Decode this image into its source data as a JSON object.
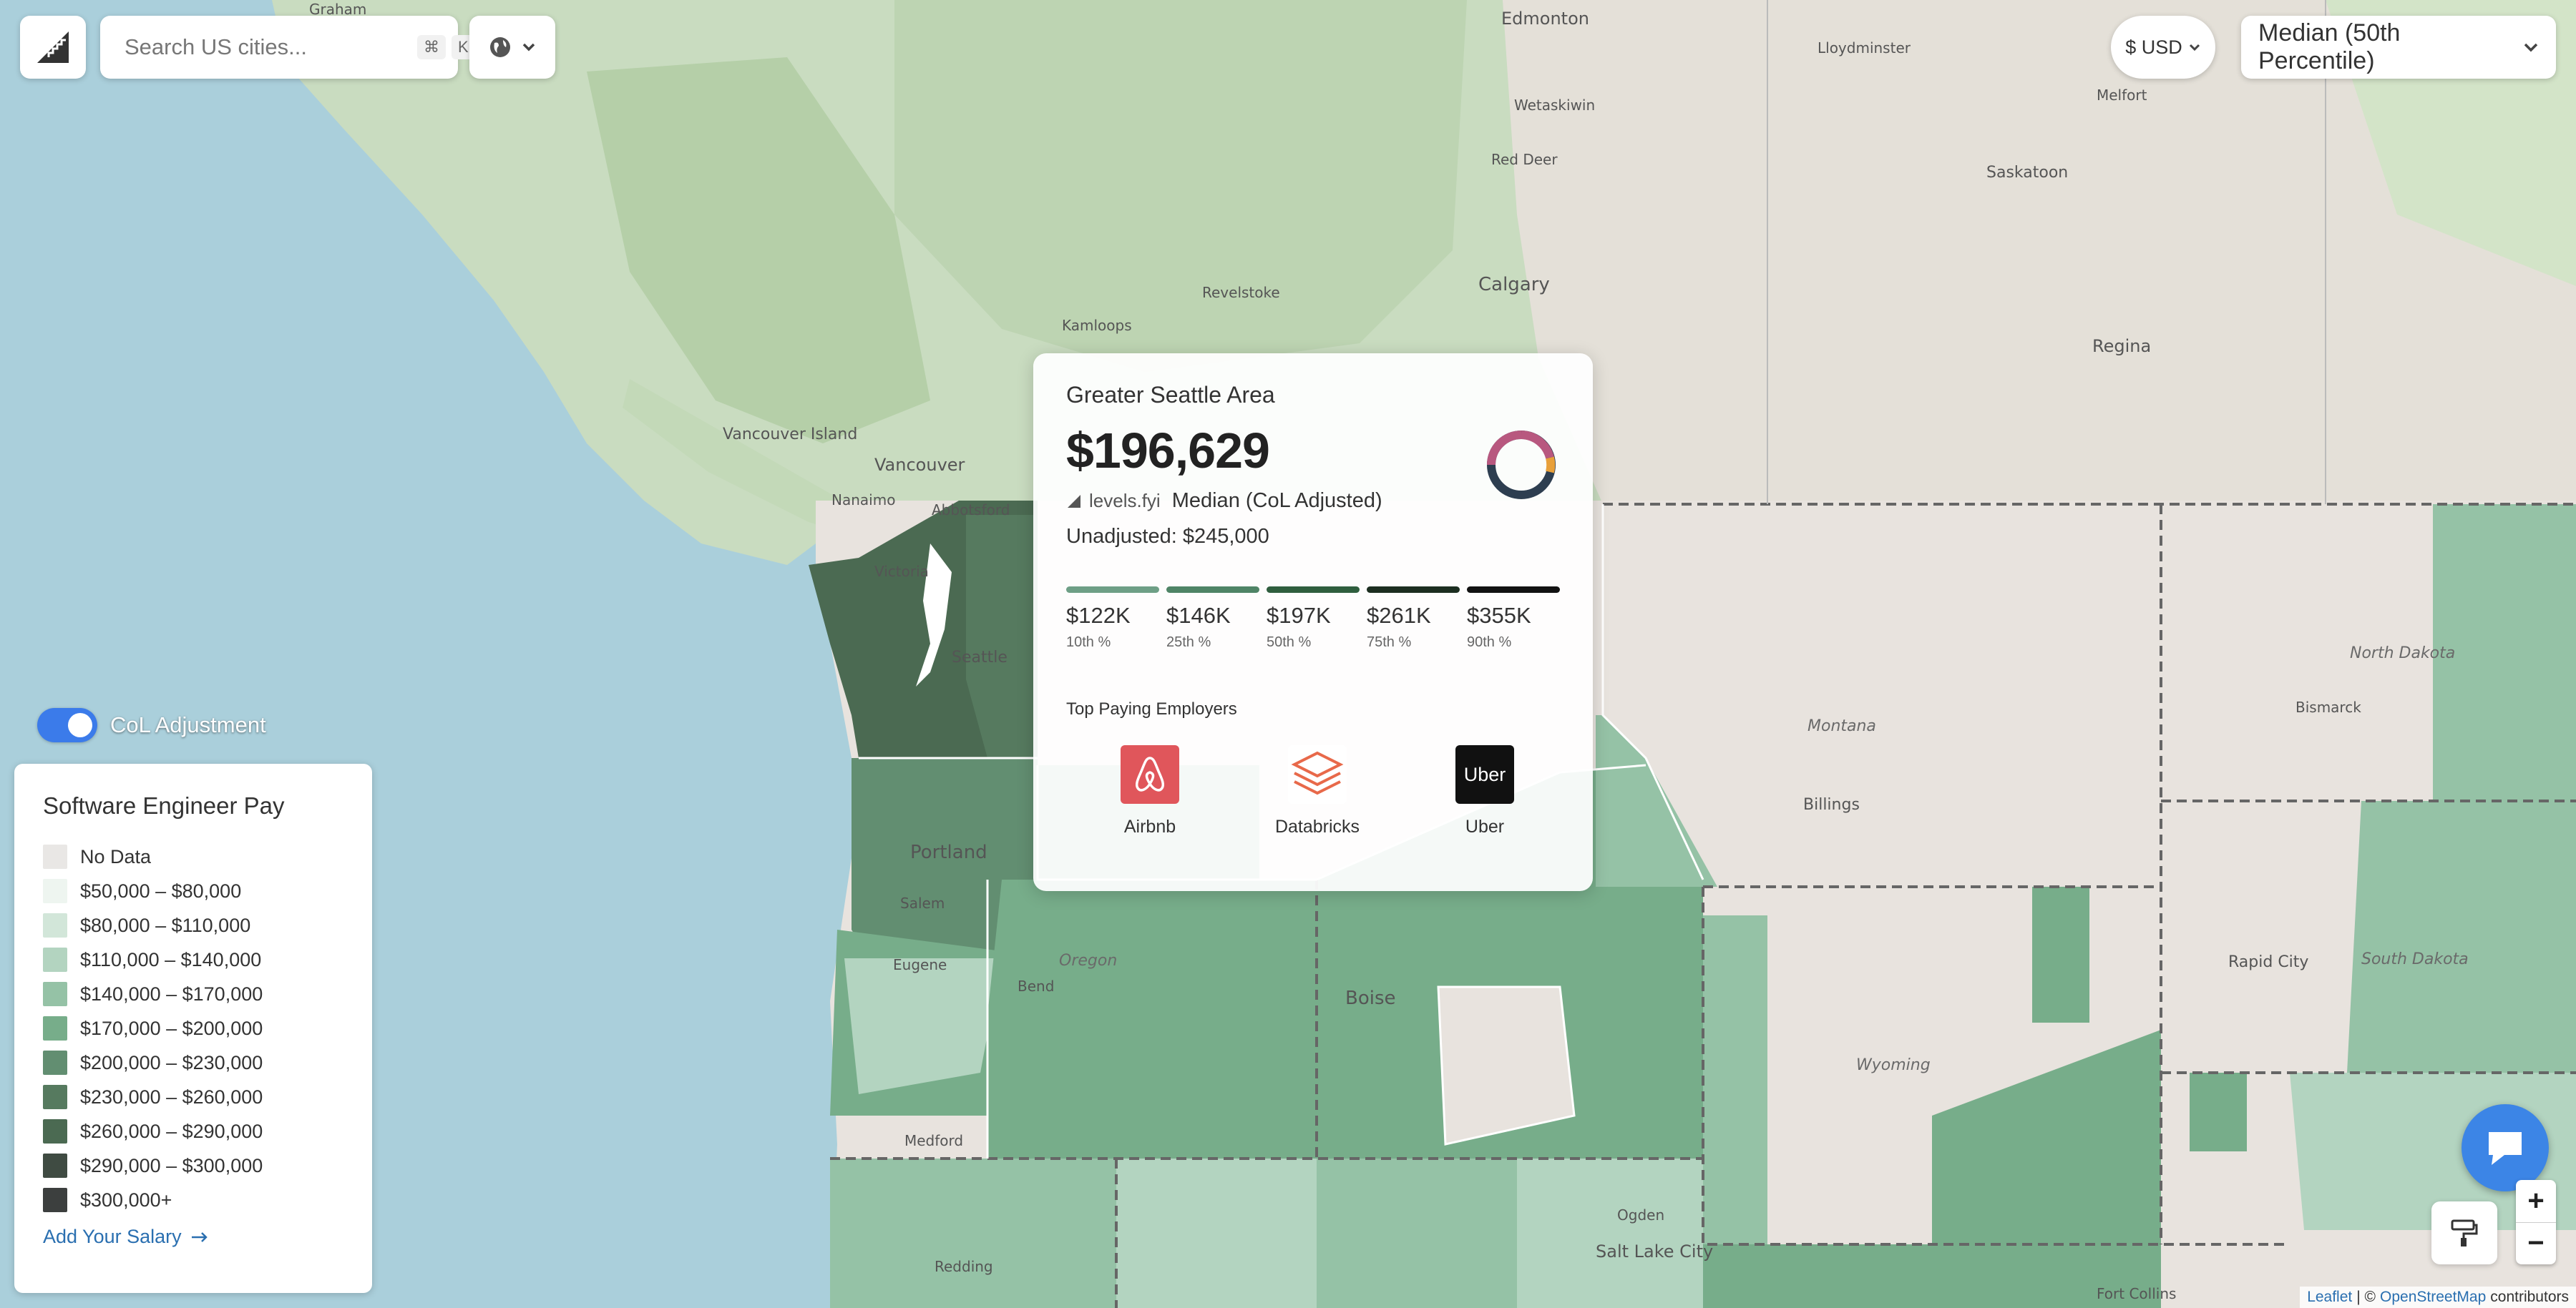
{
  "search": {
    "placeholder": "Search US cities...",
    "shortcut_cmd": "⌘",
    "shortcut_key": "K"
  },
  "currency": {
    "label": "$ USD"
  },
  "percentile": {
    "label": "Median (50th Percentile)"
  },
  "map_labels": {
    "graham": "Graham",
    "edmonton": "Edmonton",
    "lloydminster": "Lloydminster",
    "wetaskiwin": "Wetaskiwin",
    "melfort": "Melfort",
    "red_deer": "Red Deer",
    "saskatoon": "Saskatoon",
    "calgary": "Calgary",
    "revelstoke": "Revelstoke",
    "kamloops": "Kamloops",
    "regina": "Regina",
    "vancouver_island": "Vancouver Island",
    "vancouver": "Vancouver",
    "nanaimo": "Nanaimo",
    "abbotsford": "Abbotsford",
    "victoria": "Victoria",
    "seattle": "Seattle",
    "portland": "Portland",
    "salem": "Salem",
    "eugene": "Eugene",
    "bend": "Bend",
    "oregon": "Oregon",
    "medford": "Medford",
    "redding": "Redding",
    "boise": "Boise",
    "montana": "Montana",
    "billings": "Billings",
    "north_dakota": "North Dakota",
    "bismarck": "Bismarck",
    "rapid_city": "Rapid City",
    "south_dakota": "South Dakota",
    "wyoming": "Wyoming",
    "ogden": "Ogden",
    "salt_lake_city": "Salt Lake City",
    "fort_collins": "Fort Collins"
  },
  "popup": {
    "title": "Greater Seattle Area",
    "amount": "$196,629",
    "source": "levels.fyi",
    "median_label": "Median (CoL Adjusted)",
    "unadjusted": "Unadjusted: $245,000",
    "percentiles": [
      {
        "value": "$122K",
        "label": "10th %",
        "color": "#6e9f86"
      },
      {
        "value": "$146K",
        "label": "25th %",
        "color": "#4f8466"
      },
      {
        "value": "$197K",
        "label": "50th %",
        "color": "#2f5e3e"
      },
      {
        "value": "$261K",
        "label": "75th %",
        "color": "#1c2e20"
      },
      {
        "value": "$355K",
        "label": "90th %",
        "color": "#121212"
      }
    ],
    "employers_title": "Top Paying Employers",
    "employers": [
      {
        "name": "Airbnb",
        "icon": "airbnb-logo-icon",
        "bg": "#e0565b"
      },
      {
        "name": "Databricks",
        "icon": "databricks-logo-icon",
        "bg": "#ffffff"
      },
      {
        "name": "Uber",
        "icon": "uber-logo-icon",
        "bg": "#111111",
        "text": "Uber"
      }
    ]
  },
  "col_toggle": {
    "label": "CoL Adjustment",
    "on": true
  },
  "legend": {
    "title": "Software Engineer Pay",
    "items": [
      {
        "label": "No Data",
        "color": "#e9e7e5"
      },
      {
        "label": "$50,000 – $80,000",
        "color": "#eef5f0"
      },
      {
        "label": "$80,000 – $110,000",
        "color": "#d2e6d9"
      },
      {
        "label": "$110,000 – $140,000",
        "color": "#b3d4c0"
      },
      {
        "label": "$140,000 – $170,000",
        "color": "#95c2a6"
      },
      {
        "label": "$170,000 – $200,000",
        "color": "#77ad8a"
      },
      {
        "label": "$200,000 – $230,000",
        "color": "#628e71"
      },
      {
        "label": "$230,000 – $260,000",
        "color": "#567a5f"
      },
      {
        "label": "$260,000 – $290,000",
        "color": "#4b6a52"
      },
      {
        "label": "$290,000 – $300,000",
        "color": "#3f4b42"
      },
      {
        "label": "$300,000+",
        "color": "#3c3f3e"
      }
    ],
    "add_salary": "Add Your Salary"
  },
  "zoom": {
    "in": "+",
    "out": "−"
  },
  "attribution": {
    "leaflet": "Leaflet",
    "separator": "| ©",
    "osm": "OpenStreetMap",
    "contributors": "contributors"
  }
}
